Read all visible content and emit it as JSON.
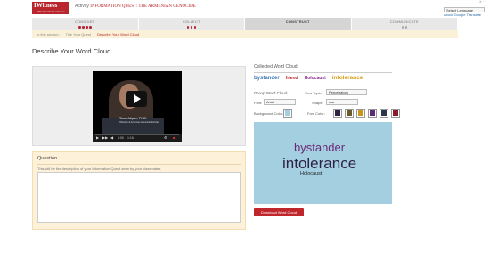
{
  "header": {
    "logo_main": "IWitness",
    "logo_sub": "USC Shoah Foundation",
    "activity_label": "Activity",
    "activity_title": "INFORMATION QUEST: THE ARMENIAN GENOCIDE",
    "top_links": "Jr  ·  ·",
    "language_select": "Select Language",
    "google_translate": "About Google Translate"
  },
  "steps": [
    {
      "label": "CONSIDER",
      "dots": 4,
      "done": 4
    },
    {
      "label": "COLLECT",
      "dots": 3,
      "done": 3
    },
    {
      "label": "CONSTRUCT",
      "dots": 0,
      "done": 0
    },
    {
      "label": "COMMUNICATE",
      "dots": 2,
      "done": 0
    }
  ],
  "breadcrumb": {
    "prefix": "In this section:",
    "item1": "Title Your Quest",
    "current": "Describe Your Word Cloud"
  },
  "page_title": "Describe Your Word Cloud",
  "video": {
    "caption": "Taner Akçam, Ph.D.",
    "caption_sub": "Historian & Armenian Genocide Scholar",
    "time": "0:00",
    "duration": "1:16",
    "progress": 0
  },
  "question": {
    "title": "Question",
    "description": "This will be the description of your Information Quest seen by your classmates.",
    "value": ""
  },
  "collected": {
    "title": "Collected Word Cloud",
    "words": [
      {
        "text": "bystander",
        "color": "#3a78b8",
        "size": "6px"
      },
      {
        "text": "friend",
        "color": "#b8252c",
        "size": "5px"
      },
      {
        "text": "Holocaust",
        "color": "#8b2a8f",
        "size": "5px"
      },
      {
        "text": "intolerance",
        "color": "#d4a017",
        "size": "6.5px"
      }
    ]
  },
  "controls": {
    "group_label": "Group Word Cloud",
    "topic_label": "Your Topic:",
    "topic_value": "Perpetrators",
    "font_label": "Font:",
    "font_value": "Arial",
    "shape_label": "Shape:",
    "shape_value": "star",
    "bg_color_label": "Background Color:",
    "bg_color": "#a3cfe0",
    "font_color_label": "Font Color:",
    "font_colors": [
      "#2e2245",
      "#6b5b2a",
      "#c9961b",
      "#5b2a78",
      "#2d3548",
      "#8b1a2a"
    ]
  },
  "cloud": {
    "background": "#a3cfe0",
    "words": [
      "bystander",
      "intolerance",
      "Holocaust"
    ]
  },
  "download_label": "Download Word Cloud"
}
